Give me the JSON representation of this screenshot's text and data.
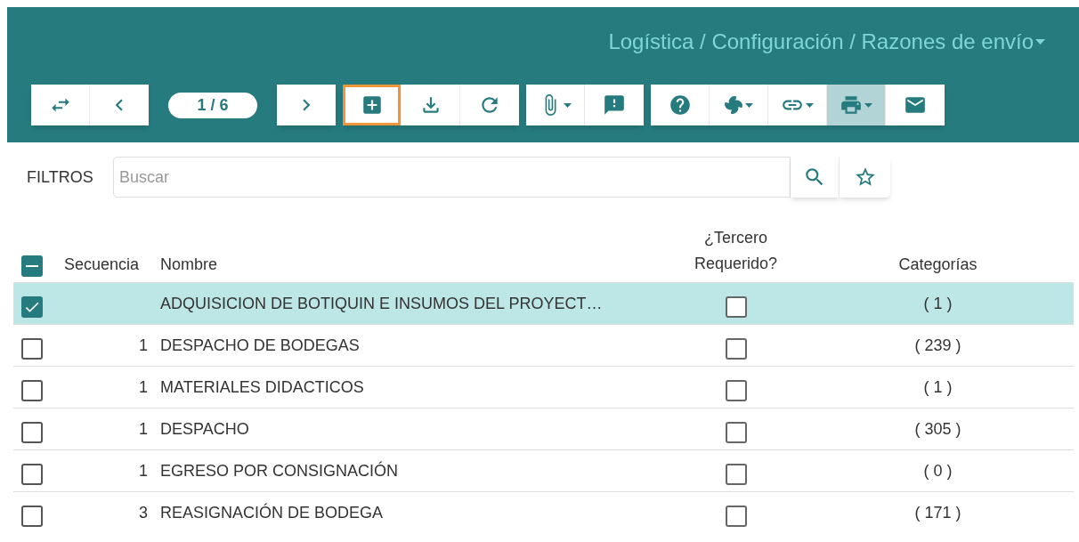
{
  "breadcrumb": {
    "text": "Logística / Configuración / Razones de envío",
    "dropdown": true
  },
  "toolbar": [
    {
      "kind": "group",
      "buttons": [
        {
          "dropdown": false,
          "focused": false,
          "active": false
        },
        {
          "dropdown": false,
          "focused": false,
          "active": false
        }
      ]
    },
    {
      "kind": "pager",
      "text": "1 / 6"
    },
    {
      "kind": "group",
      "buttons": [
        {
          "dropdown": false,
          "focused": false,
          "active": false
        }
      ]
    },
    {
      "kind": "group",
      "buttons": [
        {
          "dropdown": false,
          "focused": true,
          "active": false
        },
        {
          "dropdown": false,
          "focused": false,
          "active": false
        },
        {
          "dropdown": false,
          "focused": false,
          "active": false
        }
      ]
    },
    {
      "kind": "group",
      "buttons": [
        {
          "dropdown": true,
          "focused": false,
          "active": false
        },
        {
          "dropdown": false,
          "focused": false,
          "active": false
        }
      ]
    },
    {
      "kind": "group",
      "buttons": [
        {
          "dropdown": false,
          "focused": false,
          "active": false
        },
        {
          "dropdown": true,
          "focused": false,
          "active": false
        },
        {
          "dropdown": true,
          "focused": false,
          "active": false
        },
        {
          "dropdown": true,
          "focused": false,
          "active": true
        },
        {
          "dropdown": false,
          "focused": false,
          "active": false
        }
      ]
    }
  ],
  "filters": {
    "label": "FILTROS",
    "placeholder": "Buscar"
  },
  "table": {
    "select_all_partial": true,
    "columns": [
      "Secuencia",
      "Nombre",
      "¿Tercero Requerido?",
      "Categorías"
    ],
    "rows": [
      {
        "selected": true,
        "sequence": "",
        "name": "ADQUISICION DE BOTIQUIN E INSUMOS DEL PROYECT…",
        "third_party": false,
        "categories": "( 1 )"
      },
      {
        "selected": false,
        "sequence": "1",
        "name": "DESPACHO DE BODEGAS",
        "third_party": false,
        "categories": "( 239 )"
      },
      {
        "selected": false,
        "sequence": "1",
        "name": "MATERIALES DIDACTICOS",
        "third_party": false,
        "categories": "( 1 )"
      },
      {
        "selected": false,
        "sequence": "1",
        "name": "DESPACHO",
        "third_party": false,
        "categories": "( 305 )"
      },
      {
        "selected": false,
        "sequence": "1",
        "name": "EGRESO POR CONSIGNACIÓN",
        "third_party": false,
        "categories": "( 0 )"
      },
      {
        "selected": false,
        "sequence": "3",
        "name": "REASIGNACIÓN DE BODEGA",
        "third_party": false,
        "categories": "( 171 )"
      }
    ]
  }
}
